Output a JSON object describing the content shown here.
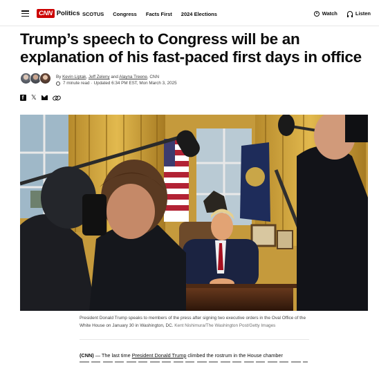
{
  "header": {
    "brand": "CNN",
    "section": "Politics",
    "nav": [
      "SCOTUS",
      "Congress",
      "Facts First",
      "2024 Elections"
    ],
    "watch_label": "Watch",
    "listen_label": "Listen"
  },
  "article": {
    "headline": "Trump’s speech to Congress will be an explanation of his fast-paced first days in office",
    "byline_prefix": "By",
    "authors": [
      "Kevin Liptak",
      "Jeff Zeleny",
      "Alayna Treene"
    ],
    "author_sep_1": ",",
    "author_sep_2": "and",
    "outlet": ", CNN",
    "read_time": "7 minute read",
    "meta_sep": "·",
    "updated": "Updated 6:34 PM EST, Mon March 3, 2025",
    "share_icons": [
      "facebook-icon",
      "x-icon",
      "email-icon",
      "link-icon"
    ],
    "image_caption": "President Donald Trump speaks to members of the press after signing two executive orders in the Oval Office of the White House on January 30 in Washington, DC.",
    "image_credit": "Kent Nishimura/The Washington Post/Getty Images",
    "body_source": "(CNN)",
    "body_dash": " — The last time ",
    "body_link": "President Donald Trump",
    "body_rest": " climbed the rostrum in the House chamber"
  },
  "colors": {
    "brand_red": "#cc0000",
    "text": "#0c0c0c",
    "muted": "#404040"
  }
}
